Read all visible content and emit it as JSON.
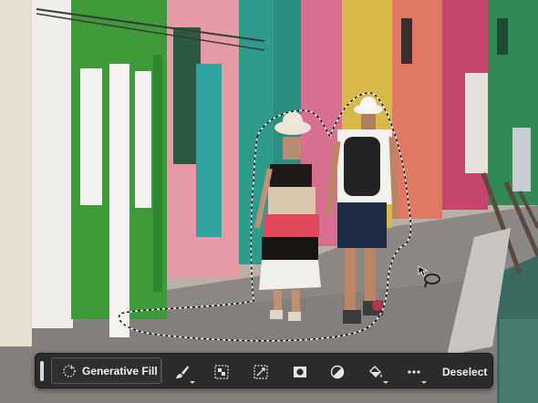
{
  "toolbar": {
    "generative_fill_label": "Generative Fill",
    "deselect_label": "Deselect",
    "tools": [
      {
        "name": "brush-icon"
      },
      {
        "name": "mask-icon"
      },
      {
        "name": "transform-icon"
      },
      {
        "name": "layer-mask-icon"
      },
      {
        "name": "adjustment-icon"
      },
      {
        "name": "fill-icon"
      },
      {
        "name": "more-icon"
      }
    ]
  }
}
